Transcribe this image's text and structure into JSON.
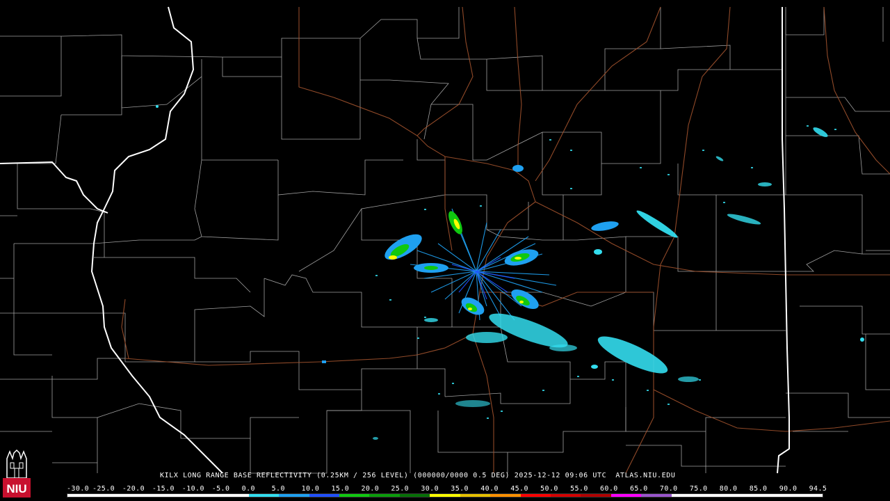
{
  "caption": "KILX LONG RANGE BASE REFLECTIVITY (0.25KM / 256 LEVEL) (000000/0000 0.5 DEG) 2025-12-12 09:06 UTC  ATLAS.NIU.EDU",
  "colorbar": {
    "ticks": [
      "-30.0",
      "-25.0",
      "-20.0",
      "-15.0",
      "-10.0",
      "-5.0",
      "0.0",
      "5.0",
      "10.0",
      "15.0",
      "20.0",
      "25.0",
      "30.0",
      "35.0",
      "40.0",
      "45.0",
      "50.0",
      "55.0",
      "60.0",
      "65.0",
      "70.0",
      "75.0",
      "80.0",
      "85.0",
      "90.0",
      "94.5"
    ],
    "colors": [
      "#ffffff",
      "#ffffff",
      "#ffffff",
      "#ffffff",
      "#ffffff",
      "#ffffff",
      "#33ddee",
      "#1fa0f0",
      "#2050ff",
      "#10c810",
      "#0a9c0a",
      "#067006",
      "#ffff00",
      "#e6c000",
      "#ff9000",
      "#ff0000",
      "#d40000",
      "#b00000",
      "#ff00ff",
      "#9955cc",
      "#ffffff",
      "#ffffff",
      "#ffffff",
      "#ffffff",
      "#ffffff"
    ]
  },
  "logo": {
    "text": "NIU",
    "color": "#c8102e"
  },
  "map_colors": {
    "background": "#000000",
    "county_lines": "#b4b4b4",
    "state_lines": "#ffffff",
    "highways": "#a0522d",
    "echo_light": "#33ddee",
    "echo_mid": "#1fa0f0",
    "echo_heavy": "#10c810",
    "echo_core": "#ffff00"
  }
}
